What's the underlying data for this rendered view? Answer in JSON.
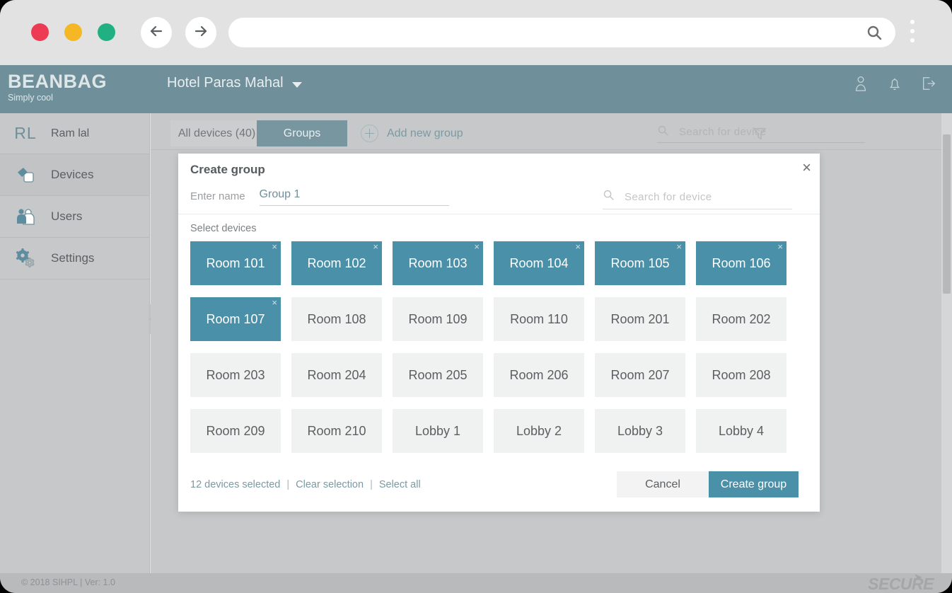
{
  "browser": {
    "traffic_lights": [
      "red",
      "yellow",
      "green"
    ],
    "back_icon": "arrow-left-icon",
    "forward_icon": "arrow-right-icon",
    "url_value": "",
    "url_placeholder": "",
    "search_icon": "search-icon",
    "menu_icon": "kebab-menu-icon"
  },
  "app_header": {
    "brand_line1": "BEANBAG",
    "brand_line2": "Simply cool",
    "property": "Hotel Paras Mahal",
    "icons": [
      "person-icon",
      "bell-icon",
      "logout-icon"
    ]
  },
  "sidebar": {
    "user": {
      "initials": "RL",
      "name": "Ram lal"
    },
    "items": [
      {
        "label": "Devices",
        "icon": "devices-icon",
        "active": true
      },
      {
        "label": "Users",
        "icon": "users-icon",
        "active": false
      },
      {
        "label": "Settings",
        "icon": "settings-gear-icon",
        "active": false
      }
    ],
    "collapse_icon": "chevron-left-icon"
  },
  "toolbar": {
    "tab_all_devices": "All devices (40)",
    "tab_groups": "Groups",
    "add_new_group": "Add new group",
    "search_placeholder": "Search for device",
    "search_value": "",
    "filter_icon": "funnel-filter-icon"
  },
  "modal": {
    "title": "Create group",
    "close_label": "×",
    "name_label": "Enter name",
    "name_value": "Group 1",
    "search_placeholder": "Search for device",
    "search_value": "",
    "select_devices_label": "Select devices",
    "devices": [
      {
        "label": "Room 101",
        "selected": true
      },
      {
        "label": "Room 102",
        "selected": true
      },
      {
        "label": "Room 103",
        "selected": true
      },
      {
        "label": "Room 104",
        "selected": true
      },
      {
        "label": "Room 105",
        "selected": true
      },
      {
        "label": "Room 106",
        "selected": true
      },
      {
        "label": "Room 107",
        "selected": true
      },
      {
        "label": "Room 108",
        "selected": false
      },
      {
        "label": "Room 109",
        "selected": false
      },
      {
        "label": "Room 110",
        "selected": false
      },
      {
        "label": "Room 201",
        "selected": false
      },
      {
        "label": "Room 202",
        "selected": false
      },
      {
        "label": "Room 203",
        "selected": false
      },
      {
        "label": "Room 204",
        "selected": false
      },
      {
        "label": "Room 205",
        "selected": false
      },
      {
        "label": "Room 206",
        "selected": false
      },
      {
        "label": "Room 207",
        "selected": false
      },
      {
        "label": "Room 208",
        "selected": false
      },
      {
        "label": "Room 209",
        "selected": false
      },
      {
        "label": "Room 210",
        "selected": false
      },
      {
        "label": "Lobby 1",
        "selected": false
      },
      {
        "label": "Lobby 2",
        "selected": false
      },
      {
        "label": "Lobby 3",
        "selected": false
      },
      {
        "label": "Lobby 4",
        "selected": false
      }
    ],
    "selection_count_label": "12 devices selected",
    "clear_selection_label": "Clear selection",
    "select_all_label": "Select all",
    "separator": "|",
    "cancel_label": "Cancel",
    "create_label": "Create group",
    "tile_remove_label": "×"
  },
  "footer": {
    "copyright": "© 2018 SIHPL  |   Ver: 1.0",
    "secure_logo": "SECURE"
  },
  "colors": {
    "accent": "#4a90a8",
    "header": "#6f909a",
    "sidebar": "#c6c8c9",
    "tile_off": "#f0f1f1",
    "link": "#7b9aa3"
  }
}
